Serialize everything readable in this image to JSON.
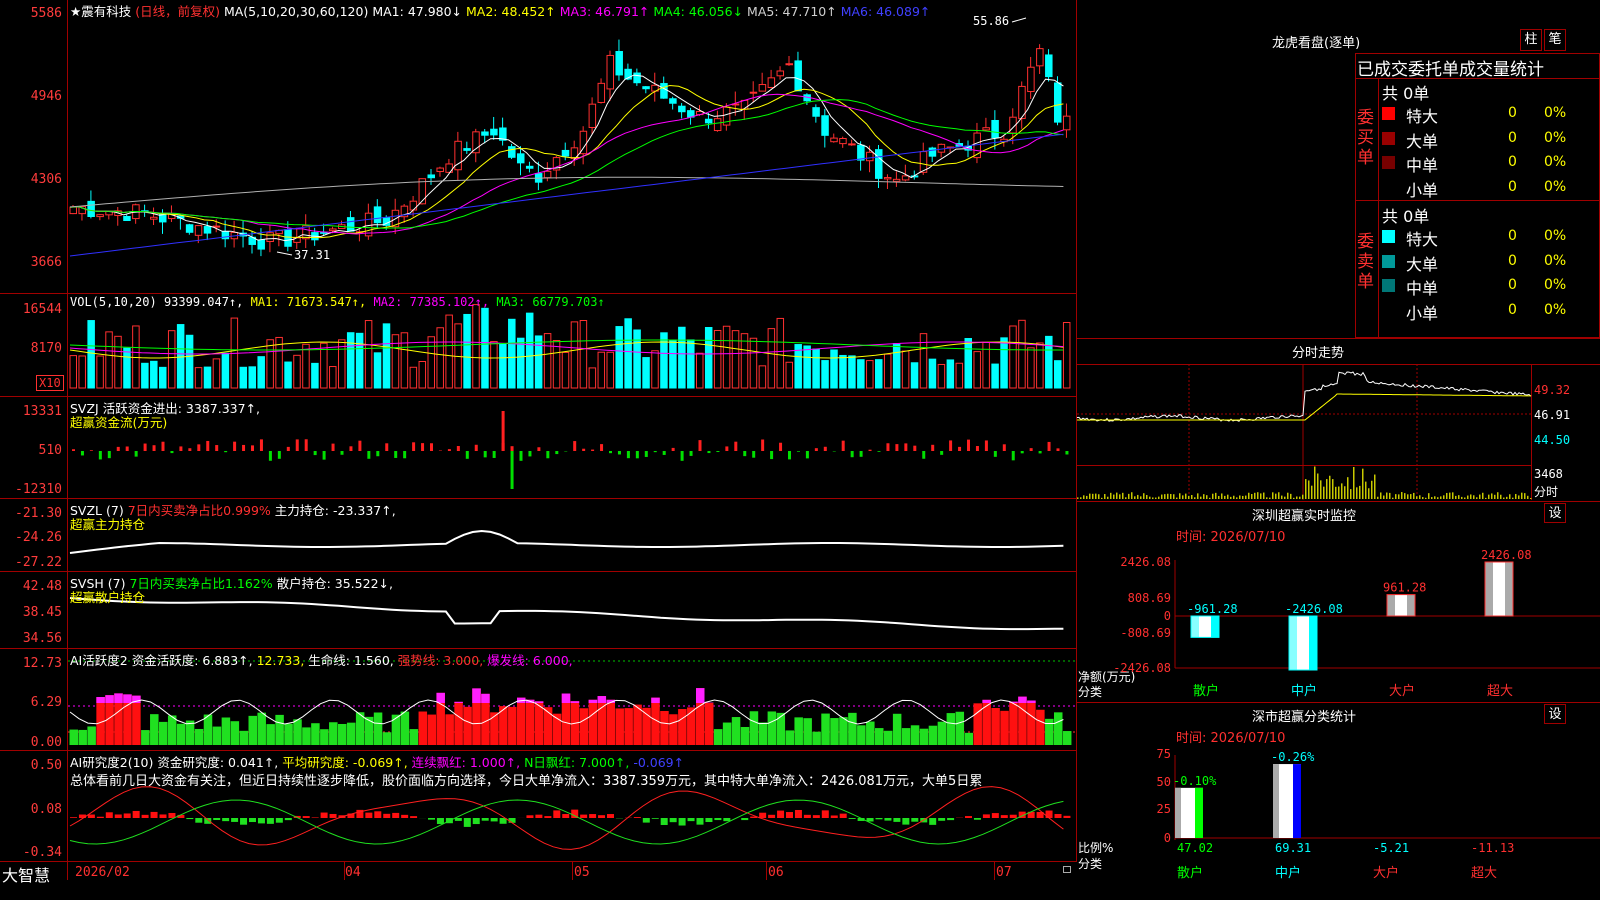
{
  "main_header": {
    "stock_name": "★震有科技",
    "period_label": "(日线，前复权)",
    "ma_params": "MA(5,10,20,30,60,120)",
    "ma1": "MA1: 47.980↓",
    "ma2": "MA2: 48.452↑",
    "ma3": "MA3: 46.791↑",
    "ma4": "MA4: 46.056↓",
    "ma5": "MA5: 47.710↑",
    "ma6": "MA6: 46.089↑"
  },
  "price_axis": [
    "5586",
    "4946",
    "4306",
    "3666"
  ],
  "price_marks": {
    "high": "55.86",
    "low": "37.31"
  },
  "vol_header": {
    "label": "VOL(5,10,20)",
    "v": "93399.047↑,",
    "ma1": "MA1: 71673.547↑,",
    "ma2": "MA2: 77385.102↑,",
    "ma3": "MA3: 66779.703↑"
  },
  "vol_axis": [
    "16544",
    "8170"
  ],
  "vol_unit": "X10",
  "svzj": {
    "label": "SVZJ",
    "text": "活跃资金进出: 3387.337↑,",
    "sub": "超赢资金流(万元)",
    "axis": [
      "13331",
      "510",
      "-12310"
    ]
  },
  "svzl": {
    "label": "SVZL (7)",
    "ratio": "7日内买卖净占比0.999%",
    "hold": "主力持仓: -23.337↑,",
    "sub": "超赢主力持仓",
    "axis": [
      "-21.30",
      "-24.26",
      "-27.22"
    ]
  },
  "svsh": {
    "label": "SVSH (7)",
    "ratio": "7日内买卖净占比1.162%",
    "hold": "散户持仓: 35.522↓,",
    "sub": "超赢散户持仓",
    "axis": [
      "42.48",
      "38.45",
      "34.56"
    ]
  },
  "ai_active": {
    "label": "AI活跃度2",
    "l1": "资金活跃度: 6.883↑,",
    "l2": "12.733,",
    "l3": "生命线: 1.560,",
    "l4": "强势线: 3.000,",
    "l5": "爆发线: 6.000,",
    "axis": [
      "12.73",
      "6.29",
      "0.00"
    ]
  },
  "ai_research": {
    "label": "AI研究度2(10)",
    "l1": "资金研究度: 0.041↑,",
    "l2": "平均研究度: -0.069↑,",
    "l3": "连续飘红: 1.000↑,",
    "l4": "N日飘红: 7.000↑,",
    "l5": "-0.069↑",
    "summary": "总体看前几日大资金有关注，但近日持续性逐步降低，股价面临方向选择，今日大单净流入：3387.359万元，其中特大单净流入：2426.081万元，大单5日累",
    "axis": [
      "0.50",
      "0.08",
      "-0.34"
    ]
  },
  "date_axis": {
    "brand": "大智慧",
    "labels": [
      "2026/02",
      "04",
      "05",
      "06",
      "07"
    ]
  },
  "longhu": {
    "title": "龙虎看盘(逐单)",
    "btn1": "柱",
    "btn2": "笔",
    "header": "已成交委托单成交量统计",
    "buy_label": "委买单",
    "sell_label": "委卖单",
    "buy_total": "共 0单",
    "sell_total": "共 0单",
    "buy_rows": [
      {
        "name": "特大",
        "v": "0",
        "p": "0%",
        "color": "#ff0000"
      },
      {
        "name": "大单",
        "v": "0",
        "p": "0%",
        "color": "#990000"
      },
      {
        "name": "中单",
        "v": "0",
        "p": "0%",
        "color": "#770000"
      },
      {
        "name": "小单",
        "v": "0",
        "p": "0%",
        "color": ""
      }
    ],
    "sell_rows": [
      {
        "name": "特大",
        "v": "0",
        "p": "0%",
        "color": "#00ffff"
      },
      {
        "name": "大单",
        "v": "0",
        "p": "0%",
        "color": "#009999"
      },
      {
        "name": "中单",
        "v": "0",
        "p": "0%",
        "color": "#007777"
      },
      {
        "name": "小单",
        "v": "0",
        "p": "0%",
        "color": ""
      }
    ]
  },
  "intraday": {
    "title": "分时走势",
    "p1": "49.32",
    "p2": "46.91",
    "p3": "44.50",
    "vol": "3468",
    "vol_unit": "分时"
  },
  "sz_monitor": {
    "title": "深圳超赢实时监控",
    "btn": "设",
    "time": "时间: 2026/07/10",
    "axis": [
      "2426.08",
      "808.69",
      "0",
      "-808.69",
      "-2426.08"
    ],
    "ylabel": "净额(万元)",
    "xlabel": "分类",
    "categories": [
      "散户",
      "中户",
      "大户",
      "超大"
    ],
    "values": [
      -961.28,
      -2426.08,
      961.28,
      2426.08
    ],
    "value_labels": [
      "-961.28",
      "-2426.08",
      "961.28",
      "2426.08"
    ]
  },
  "sz_class": {
    "title": "深市超赢分类统计",
    "btn": "设",
    "time": "时间: 2026/07/10",
    "axis": [
      "75",
      "50",
      "25",
      "0"
    ],
    "ylabel": "比例%",
    "xlabel": "分类",
    "categories": [
      "散户",
      "中户",
      "大户",
      "超大"
    ],
    "values": [
      47.02,
      69.31,
      -5.21,
      -11.13
    ],
    "value_labels": [
      "47.02",
      "69.31",
      "-5.21",
      "-11.13"
    ],
    "diff_labels": [
      "-0.10%",
      "-0.26%"
    ]
  }
}
